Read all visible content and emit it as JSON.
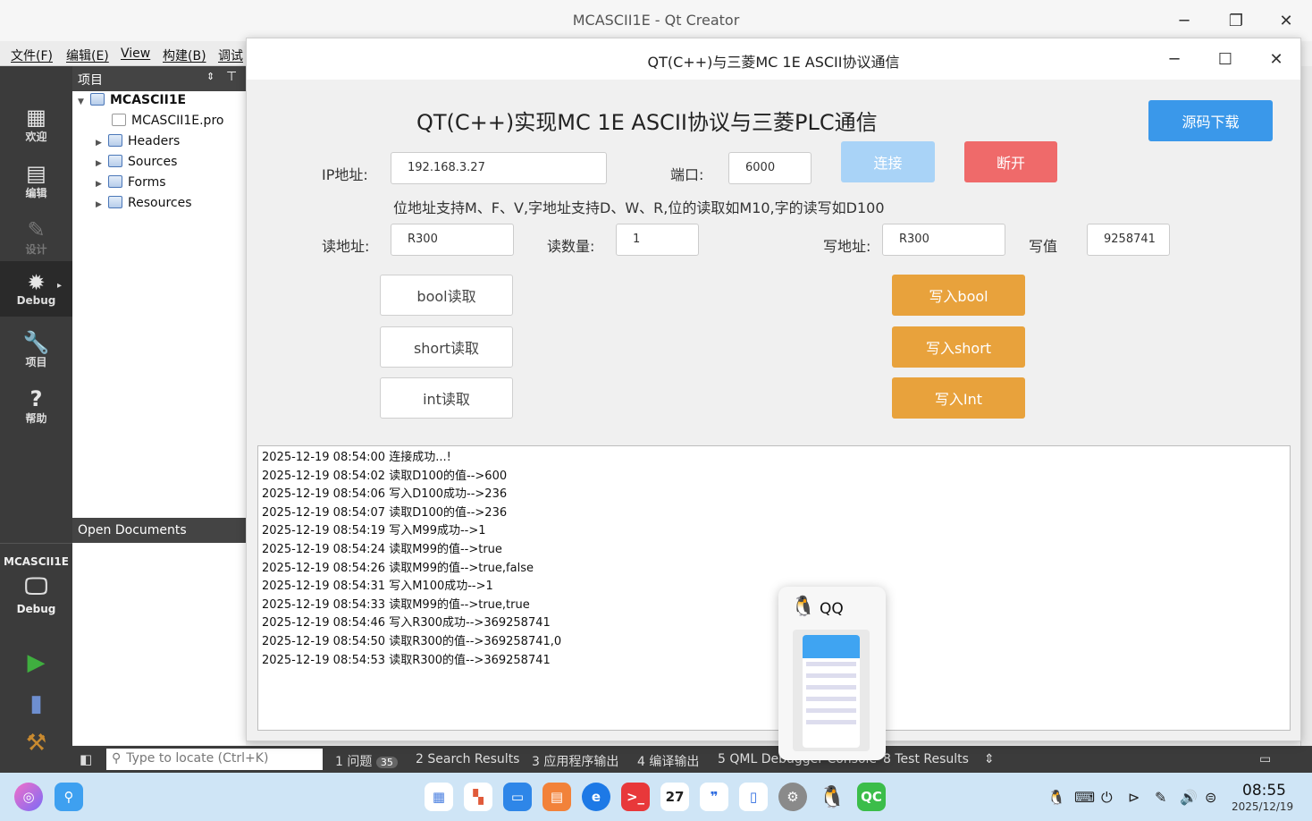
{
  "qtcreator": {
    "window_title": "MCASCII1E - Qt Creator",
    "menus": [
      "文件(F)",
      "编辑(E)",
      "View",
      "构建(B)",
      "调试"
    ],
    "modes": [
      {
        "label": "欢迎",
        "icon": "grid-icon"
      },
      {
        "label": "编辑",
        "icon": "document-icon"
      },
      {
        "label": "设计",
        "icon": "pencil-icon"
      },
      {
        "label": "Debug",
        "icon": "bug-icon"
      },
      {
        "label": "项目",
        "icon": "wrench-icon"
      },
      {
        "label": "帮助",
        "icon": "help-icon"
      }
    ],
    "kit": {
      "project": "MCASCII1E",
      "mode": "Debug"
    },
    "project_panel": {
      "title": "项目",
      "root": "MCASCII1E",
      "items": [
        "MCASCII1E.pro",
        "Headers",
        "Sources",
        "Forms",
        "Resources"
      ]
    },
    "open_documents_title": "Open Documents",
    "locator_placeholder": "Type to locate (Ctrl+K)",
    "output_tabs": [
      {
        "num": "1",
        "label": "问题",
        "badge": "35"
      },
      {
        "num": "2",
        "label": "Search Results"
      },
      {
        "num": "3",
        "label": "应用程序输出"
      },
      {
        "num": "4",
        "label": "编译输出"
      },
      {
        "num": "5",
        "label": "QML Debugger Console"
      },
      {
        "num": "8",
        "label": "Test Results"
      }
    ]
  },
  "app": {
    "window_title": "QT(C++)与三菱MC 1E ASCII协议通信",
    "headline": "QT(C++)实现MC 1E ASCII协议与三菱PLC通信",
    "download_button": "源码下载",
    "ip_label": "IP地址:",
    "ip_value": "192.168.3.27",
    "port_label": "端口:",
    "port_value": "6000",
    "connect_button": "连接",
    "disconnect_button": "断开",
    "hint": "位地址支持M、F、V,字地址支持D、W、R,位的读取如M10,字的读写如D100",
    "read_addr_label": "读地址:",
    "read_addr_value": "R300",
    "read_count_label": "读数量:",
    "read_count_value": "1",
    "write_addr_label": "写地址:",
    "write_addr_value": "R300",
    "write_value_label": "写值",
    "write_value": "9258741",
    "read_buttons": [
      "bool读取",
      "short读取",
      "int读取"
    ],
    "write_buttons": [
      "写入bool",
      "写入short",
      "写入Int"
    ],
    "log": [
      "2025-12-19 08:54:00 连接成功...!",
      "2025-12-19 08:54:02 读取D100的值-->600",
      "2025-12-19 08:54:06 写入D100成功-->236",
      "2025-12-19 08:54:07 读取D100的值-->236",
      "2025-12-19 08:54:19 写入M99成功-->1",
      "2025-12-19 08:54:24 读取M99的值-->true",
      "2025-12-19 08:54:26 读取M99的值-->true,false",
      "2025-12-19 08:54:31 写入M100成功-->1",
      "2025-12-19 08:54:33 读取M99的值-->true,true",
      "2025-12-19 08:54:46 写入R300成功-->369258741",
      "2025-12-19 08:54:50 读取R300的值-->369258741,0",
      "2025-12-19 08:54:53 读取R300的值-->369258741"
    ],
    "colors": {
      "connect": "#a9d3f7",
      "disconnect": "#ef6a6a",
      "download": "#3a98ea",
      "write": "#e8a23c"
    }
  },
  "qq_preview": {
    "label": "QQ"
  },
  "taskbar": {
    "calendar_day": "27",
    "qc_label": "QC",
    "time": "08:55",
    "date": "2025/12/19"
  }
}
